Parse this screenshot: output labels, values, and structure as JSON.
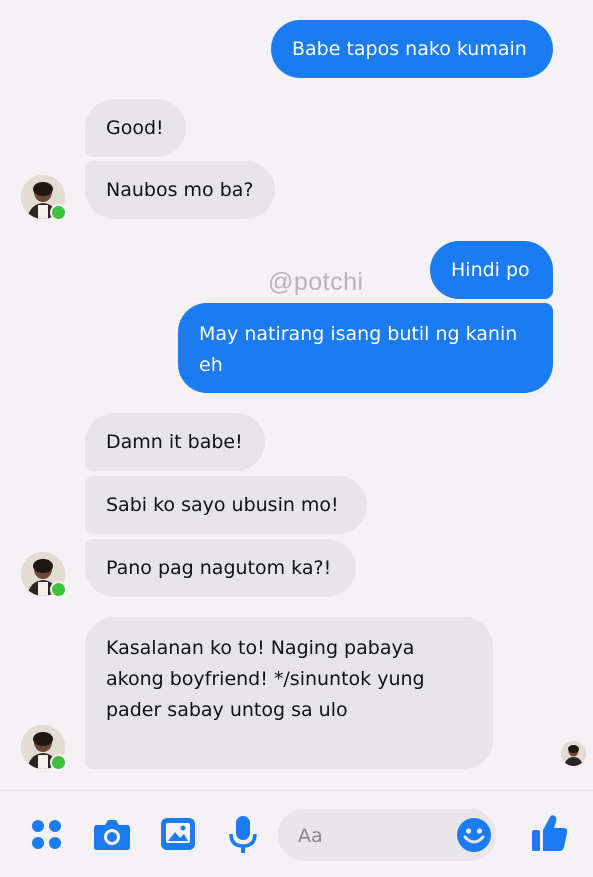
{
  "messages": [
    {
      "direction": "outgoing",
      "text": "Babe tapos nako kumain"
    },
    {
      "direction": "incoming",
      "text": "Good!"
    },
    {
      "direction": "incoming",
      "text": "Naubos mo ba?"
    },
    {
      "direction": "outgoing",
      "text": "Hindi po"
    },
    {
      "direction": "outgoing",
      "text": "May natirang isang butil ng kanin eh"
    },
    {
      "direction": "incoming",
      "text": "Damn it babe!"
    },
    {
      "direction": "incoming",
      "text": "Sabi ko sayo ubusin mo!"
    },
    {
      "direction": "incoming",
      "text": "Pano pag nagutom ka?!"
    },
    {
      "direction": "incoming",
      "text": "Kasalanan ko to! Naging pabaya akong boyfriend! */sinuntok yung pader sabay untog sa ulo"
    }
  ],
  "watermark": "@potchi",
  "composer": {
    "placeholder": "Aa",
    "icons": [
      "menu-dots-icon",
      "camera-icon",
      "gallery-icon",
      "microphone-icon",
      "emoji-icon",
      "thumbs-up-icon"
    ],
    "accent_color": "#1a7cf0"
  },
  "colors": {
    "outgoing_bubble": "#1a7cf0",
    "incoming_bubble": "#e7e5ea",
    "background": "#f4f2f5",
    "online_dot": "#3ec13b"
  }
}
